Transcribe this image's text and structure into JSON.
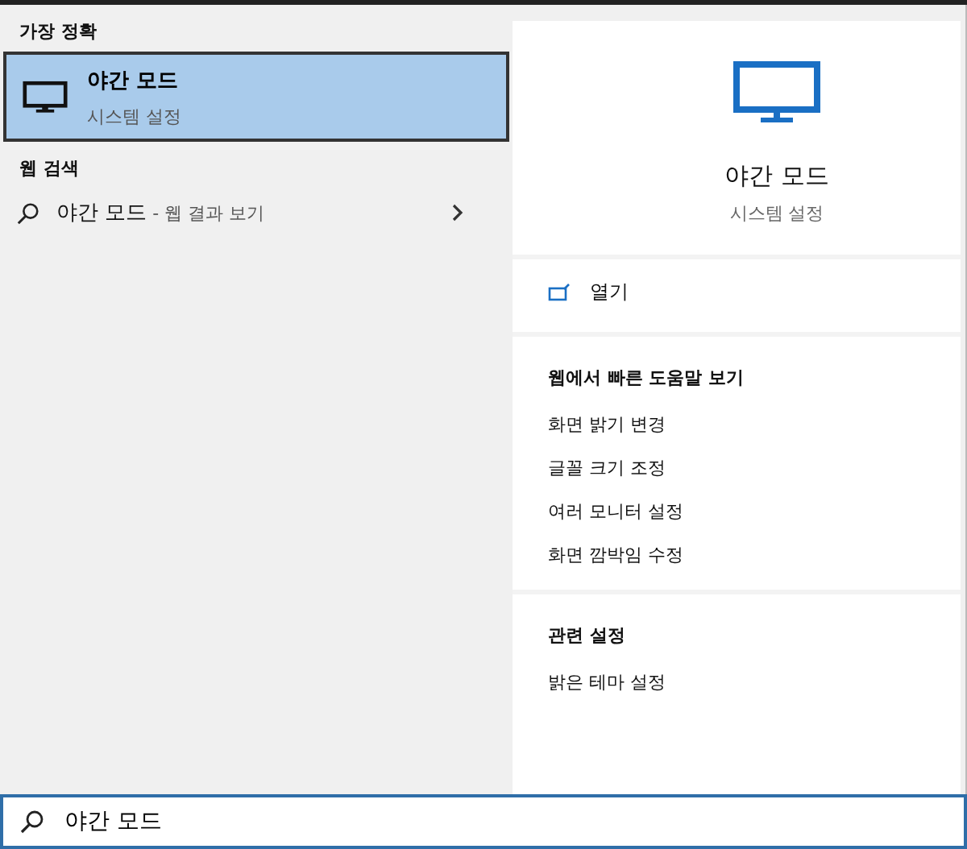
{
  "results": {
    "best_match_heading": "가장 정확",
    "best_match": [
      {
        "title": "야간 모드",
        "subtitle": "시스템 설정",
        "selected": true
      }
    ],
    "web_heading": "웹 검색",
    "web_results": [
      {
        "query": "야간 모드",
        "suffix": " - 웹 결과 보기",
        "selected": false
      }
    ]
  },
  "preview": {
    "title": "야간 모드",
    "subtitle": "시스템 설정",
    "actions": [
      {
        "label": "열기"
      }
    ],
    "sections": [
      {
        "heading": "웹에서 빠른 도움말 보기",
        "links": [
          "화면 밝기 변경",
          "글꼴 크기 조정",
          "여러 모니터 설정",
          "화면 깜박임 수정"
        ]
      },
      {
        "heading": "관련 설정",
        "links": [
          "밝은 테마 설정"
        ]
      }
    ]
  },
  "search": {
    "value": "야간 모드"
  }
}
